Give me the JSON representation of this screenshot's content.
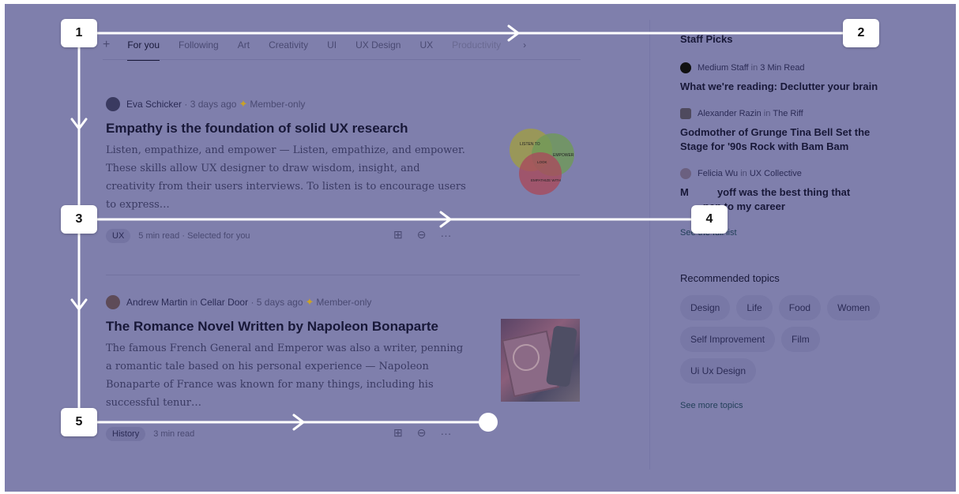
{
  "tabs": {
    "plus": "+",
    "items": [
      "For you",
      "Following",
      "Art",
      "Creativity",
      "UI",
      "UX Design",
      "UX",
      "Productivity"
    ],
    "more": "›"
  },
  "articles": [
    {
      "author": "Eva Schicker",
      "separator": "·",
      "time": "3 days ago",
      "member": "Member-only",
      "title": "Empathy is the foundation of solid UX research",
      "excerpt": "Listen, empathize, and empower — Listen, empathize, and empower. These skills allow UX designer to draw wisdom, insight, and creativity from their users interviews. To listen is to encourage users to express…",
      "chip": "UX",
      "read": "5 min read",
      "sep2": "·",
      "note": "Selected for you",
      "venn": [
        "LISTEN TO",
        "EMPOWER",
        "EMPATHIZE WITH",
        "LOOK"
      ]
    },
    {
      "author": "Andrew Martin",
      "in": "in",
      "publication": "Cellar Door",
      "separator": "·",
      "time": "5 days ago",
      "member": "Member-only",
      "title": "The Romance Novel Written by Napoleon Bonaparte",
      "excerpt": "The famous French General and Emperor was also a writer, penning a romantic tale based on his personal experience — Napoleon Bonaparte of France was known for many things, including his successful tenur…",
      "chip": "History",
      "read": "3 min read"
    }
  ],
  "actions": {
    "save": "⊕",
    "less": "⊖",
    "more": "···"
  },
  "sidebar": {
    "staff_heading": "Staff Picks",
    "picks": [
      {
        "author": "Medium Staff",
        "in": "in",
        "pub": "3 Min Read",
        "title": "What we're reading: Declutter your brain"
      },
      {
        "author": "Alexander Razin",
        "in": "in",
        "pub": "The Riff",
        "title": "Godmother of Grunge Tina Bell Set the Stage for '90s Rock with Bam Bam"
      },
      {
        "author": "Felicia Wu",
        "in": "in",
        "pub": "UX Collective",
        "title": "M          yoff was the best thing that",
        "title2": "        pen to my career"
      }
    ],
    "see_full_list": "See the full list",
    "topics_heading": "Recommended topics",
    "topics": [
      "Design",
      "Life",
      "Food",
      "Women",
      "Self Improvement",
      "Film",
      "Ui Ux Design"
    ],
    "see_more_topics": "See more topics"
  },
  "steps": [
    "1",
    "2",
    "3",
    "4",
    "5"
  ]
}
